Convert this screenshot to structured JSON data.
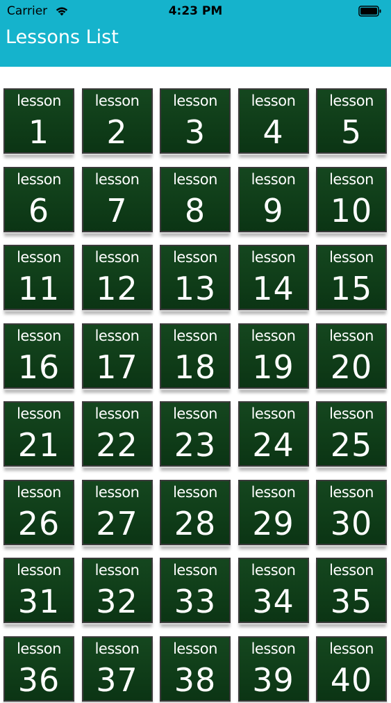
{
  "status_bar": {
    "carrier": "Carrier",
    "time": "4:23 PM",
    "icons": [
      "wifi-icon",
      "battery-icon"
    ]
  },
  "nav": {
    "title": "Lessons List"
  },
  "colors": {
    "nav_background": "#15b3cc",
    "tile_background": "#0f3c18",
    "tile_text": "#ffffff"
  },
  "lessons": [
    {
      "word": "lesson",
      "number": "1"
    },
    {
      "word": "lesson",
      "number": "2"
    },
    {
      "word": "lesson",
      "number": "3"
    },
    {
      "word": "lesson",
      "number": "4"
    },
    {
      "word": "lesson",
      "number": "5"
    },
    {
      "word": "lesson",
      "number": "6"
    },
    {
      "word": "lesson",
      "number": "7"
    },
    {
      "word": "lesson",
      "number": "8"
    },
    {
      "word": "lesson",
      "number": "9"
    },
    {
      "word": "lesson",
      "number": "10"
    },
    {
      "word": "lesson",
      "number": "11"
    },
    {
      "word": "lesson",
      "number": "12"
    },
    {
      "word": "lesson",
      "number": "13"
    },
    {
      "word": "lesson",
      "number": "14"
    },
    {
      "word": "lesson",
      "number": "15"
    },
    {
      "word": "lesson",
      "number": "16"
    },
    {
      "word": "lesson",
      "number": "17"
    },
    {
      "word": "lesson",
      "number": "18"
    },
    {
      "word": "lesson",
      "number": "19"
    },
    {
      "word": "lesson",
      "number": "20"
    },
    {
      "word": "lesson",
      "number": "21"
    },
    {
      "word": "lesson",
      "number": "22"
    },
    {
      "word": "lesson",
      "number": "23"
    },
    {
      "word": "lesson",
      "number": "24"
    },
    {
      "word": "lesson",
      "number": "25"
    },
    {
      "word": "lesson",
      "number": "26"
    },
    {
      "word": "lesson",
      "number": "27"
    },
    {
      "word": "lesson",
      "number": "28"
    },
    {
      "word": "lesson",
      "number": "29"
    },
    {
      "word": "lesson",
      "number": "30"
    },
    {
      "word": "lesson",
      "number": "31"
    },
    {
      "word": "lesson",
      "number": "32"
    },
    {
      "word": "lesson",
      "number": "33"
    },
    {
      "word": "lesson",
      "number": "34"
    },
    {
      "word": "lesson",
      "number": "35"
    },
    {
      "word": "lesson",
      "number": "36"
    },
    {
      "word": "lesson",
      "number": "37"
    },
    {
      "word": "lesson",
      "number": "38"
    },
    {
      "word": "lesson",
      "number": "39"
    },
    {
      "word": "lesson",
      "number": "40"
    }
  ]
}
